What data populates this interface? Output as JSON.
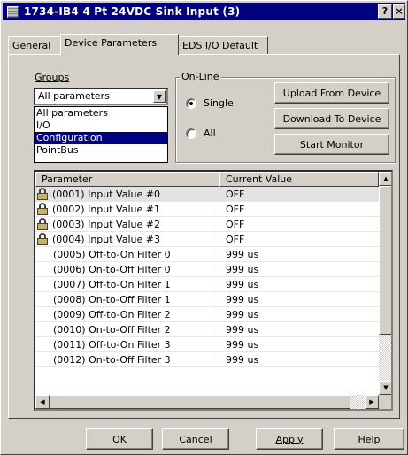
{
  "window": {
    "title": "1734-IB4 4 Pt 24VDC Sink Input (3)",
    "help_label": "?",
    "close_label": "×"
  },
  "tabs": [
    {
      "label": "General",
      "active": false
    },
    {
      "label": "Device Parameters",
      "active": true
    },
    {
      "label": "EDS I/O Default",
      "active": false
    }
  ],
  "groups": {
    "label": "Groups",
    "selected": "All parameters",
    "options": [
      "All parameters",
      "I/O",
      "Configuration",
      "PointBus"
    ],
    "highlighted": "Configuration"
  },
  "online": {
    "label": "On-Line",
    "single_label": "Single",
    "all_label": "All",
    "selected": "Single"
  },
  "buttons": {
    "upload": "Upload From Device",
    "download": "Download To Device",
    "monitor": "Start Monitor"
  },
  "grid": {
    "columns": [
      "Parameter",
      "Current Value"
    ],
    "rows": [
      {
        "param": "(0001) Input Value #0",
        "value": "OFF",
        "locked": true
      },
      {
        "param": "(0002) Input Value #1",
        "value": "OFF",
        "locked": true
      },
      {
        "param": "(0003) Input Value #2",
        "value": "OFF",
        "locked": true
      },
      {
        "param": "(0004) Input Value #3",
        "value": "OFF",
        "locked": true
      },
      {
        "param": "(0005) Off-to-On Filter 0",
        "value": "999 us",
        "locked": false
      },
      {
        "param": "(0006) On-to-Off Filter 0",
        "value": "999 us",
        "locked": false
      },
      {
        "param": "(0007) Off-to-On Filter 1",
        "value": "999 us",
        "locked": false
      },
      {
        "param": "(0008) On-to-Off Filter 1",
        "value": "999 us",
        "locked": false
      },
      {
        "param": "(0009) Off-to-On Filter 2",
        "value": "999 us",
        "locked": false
      },
      {
        "param": "(0010) On-to-Off Filter 2",
        "value": "999 us",
        "locked": false
      },
      {
        "param": "(0011) Off-to-On Filter 3",
        "value": "999 us",
        "locked": false
      },
      {
        "param": "(0012) On-to-Off Filter 3",
        "value": "999 us",
        "locked": false
      }
    ]
  },
  "footer": {
    "ok": "OK",
    "cancel": "Cancel",
    "apply": "Apply",
    "help": "Help"
  }
}
